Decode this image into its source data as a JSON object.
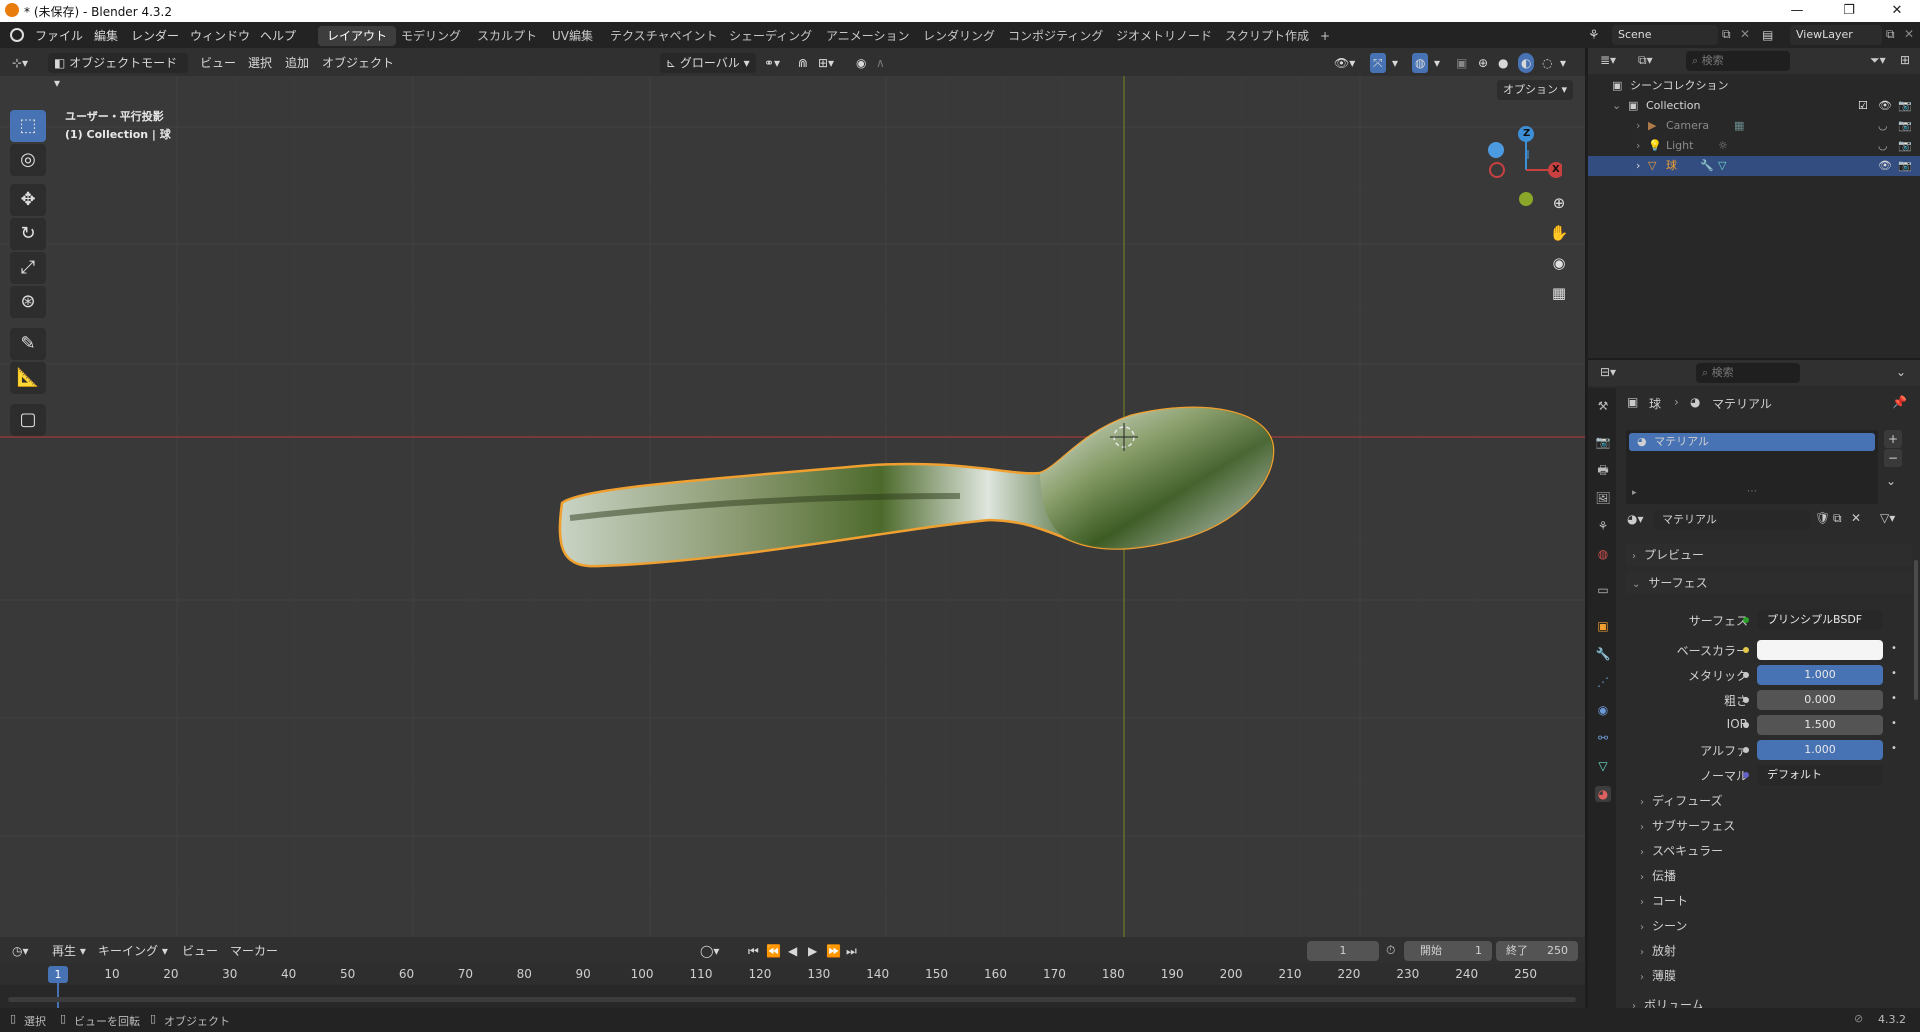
{
  "window": {
    "title": "* (未保存) - Blender 4.3.2",
    "minimize": "—",
    "maximize": "❐",
    "close": "✕"
  },
  "menu": {
    "items": [
      "ファイル",
      "編集",
      "レンダー",
      "ウィンドウ",
      "ヘルプ"
    ]
  },
  "workspaces": {
    "tabs": [
      "レイアウト",
      "モデリング",
      "スカルプト",
      "UV編集",
      "テクスチャペイント",
      "シェーディング",
      "アニメーション",
      "レンダリング",
      "コンポジティング",
      "ジオメトリノード",
      "スクリプト作成"
    ],
    "active": "レイアウト",
    "add": "+"
  },
  "scene": {
    "name": "Scene",
    "view_layer": "ViewLayer"
  },
  "viewport_header": {
    "mode": "オブジェクトモード",
    "view": "ビュー",
    "select": "選択",
    "add": "追加",
    "object": "オブジェクト",
    "transform_orientation": "グローバル",
    "options": "オプション"
  },
  "viewport": {
    "projection": "ユーザー・平行投影",
    "collection_info": "(1) Collection | 球",
    "gizmo": {
      "z": "Z",
      "x": "X"
    }
  },
  "colors": {
    "accent": "#4772b3",
    "selection_outline": "#f0a030",
    "x_axis": "#c8403f",
    "y_axis": "#8aa72a",
    "z_axis": "#3d8fd8"
  },
  "timeline": {
    "playback": "再生",
    "keying": "キーイング",
    "view": "ビュー",
    "marker": "マーカー",
    "current_frame": "1",
    "start_label": "開始",
    "start": "1",
    "end_label": "終了",
    "end": "250",
    "ruler": [
      "10",
      "20",
      "30",
      "40",
      "50",
      "60",
      "70",
      "80",
      "90",
      "100",
      "110",
      "120",
      "130",
      "140",
      "150",
      "160",
      "170",
      "180",
      "190",
      "200",
      "210",
      "220",
      "230",
      "240",
      "250"
    ],
    "playhead": "1"
  },
  "statusbar": {
    "select": "選択",
    "rotate_view": "ビューを回転",
    "object": "オブジェクト",
    "version": "4.3.2"
  },
  "outliner": {
    "search_placeholder": "検索",
    "root": "シーンコレクション",
    "collection": "Collection",
    "items": [
      {
        "name": "Camera"
      },
      {
        "name": "Light"
      },
      {
        "name": "球"
      }
    ]
  },
  "properties": {
    "search_placeholder": "検索",
    "breadcrumb": {
      "object": "球",
      "sep": "›",
      "material": "マテリアル"
    },
    "slot": "マテリアル",
    "material_name": "マテリアル",
    "panels": {
      "preview": "プレビュー",
      "surface": "サーフェス"
    },
    "surface": {
      "shader_label": "サーフェス",
      "shader": "プリンシプルBSDF",
      "base_color_label": "ベースカラー",
      "metallic_label": "メタリック",
      "metallic": "1.000",
      "roughness_label": "粗さ",
      "roughness": "0.000",
      "ior_label": "IOR",
      "ior": "1.500",
      "alpha_label": "アルファ",
      "alpha": "1.000",
      "normal_label": "ノーマル",
      "normal": "デフォルト"
    },
    "subpanels": [
      "ディフューズ",
      "サブサーフェス",
      "スペキュラー",
      "伝播",
      "コート",
      "シーン",
      "放射",
      "薄膜",
      "ボリューム"
    ]
  }
}
